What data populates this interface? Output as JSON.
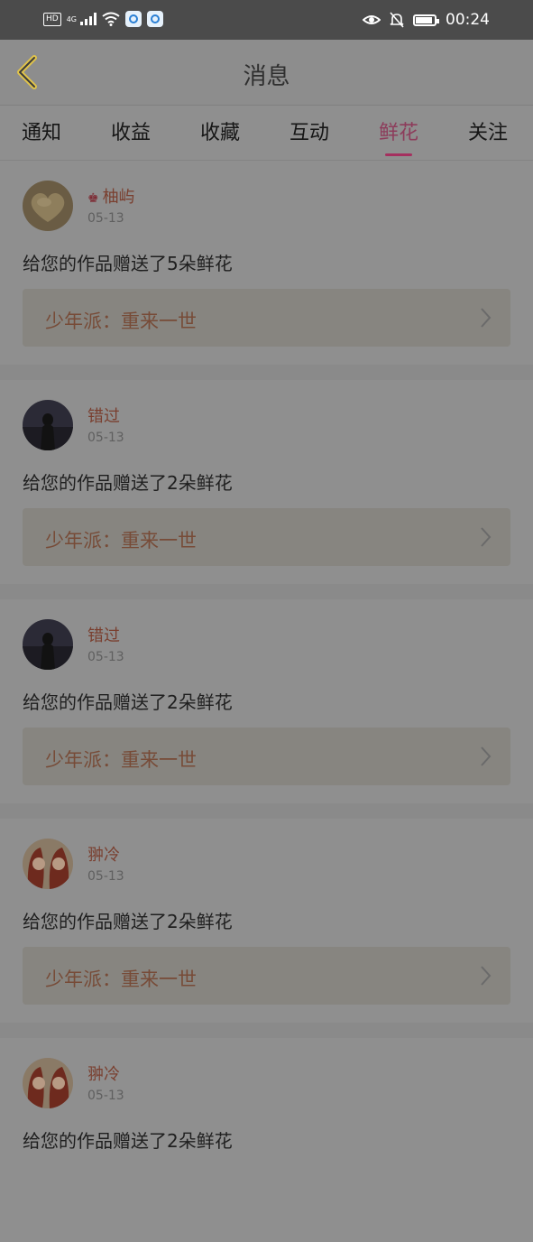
{
  "status_bar": {
    "hd": "HD",
    "network": "4G",
    "time": "00:24"
  },
  "header": {
    "title": "消息"
  },
  "tabs": [
    {
      "label": "通知",
      "active": false
    },
    {
      "label": "收益",
      "active": false
    },
    {
      "label": "收藏",
      "active": false
    },
    {
      "label": "互动",
      "active": false
    },
    {
      "label": "鲜花",
      "active": true
    },
    {
      "label": "关注",
      "active": false
    }
  ],
  "items": [
    {
      "user": "柚屿",
      "vip": true,
      "date": "05-13",
      "message": "给您的作品赠送了5朵鲜花",
      "work": "少年派：重来一世"
    },
    {
      "user": "错过",
      "vip": false,
      "date": "05-13",
      "message": "给您的作品赠送了2朵鲜花",
      "work": "少年派：重来一世"
    },
    {
      "user": "错过",
      "vip": false,
      "date": "05-13",
      "message": "给您的作品赠送了2朵鲜花",
      "work": "少年派：重来一世"
    },
    {
      "user": "翀冷",
      "vip": false,
      "date": "05-13",
      "message": "给您的作品赠送了2朵鲜花",
      "work": "少年派：重来一世"
    },
    {
      "user": "翀冷",
      "vip": false,
      "date": "05-13",
      "message": "给您的作品赠送了2朵鲜花",
      "work": ""
    }
  ]
}
